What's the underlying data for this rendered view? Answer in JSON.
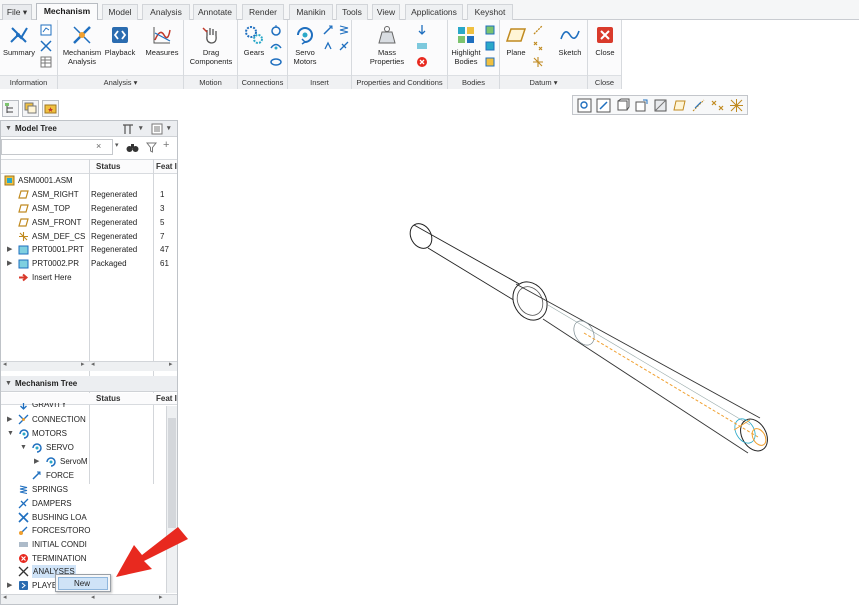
{
  "tabs": {
    "file": "File ▾",
    "mechanism": "Mechanism",
    "model": "Model",
    "analysis": "Analysis",
    "annotate": "Annotate",
    "render": "Render",
    "manikin": "Manikin",
    "tools": "Tools",
    "view": "View",
    "applications": "Applications",
    "keyshot": "Keyshot"
  },
  "ribbon": {
    "summary": "Summary",
    "mechanism_analysis_1": "Mechanism",
    "mechanism_analysis_2": "Analysis",
    "playback": "Playback",
    "measures": "Measures",
    "drag_1": "Drag",
    "drag_2": "Components",
    "gears": "Gears",
    "servo_1": "Servo",
    "servo_2": "Motors",
    "mass_1": "Mass",
    "mass_2": "Properties",
    "highlight_1": "Highlight",
    "highlight_2": "Bodies",
    "plane": "Plane",
    "sketch": "Sketch",
    "close": "Close",
    "groups": {
      "information": "Information",
      "analysis": "Analysis ▾",
      "motion": "Motion",
      "connections": "Connections",
      "insert": "Insert",
      "properties": "Properties and Conditions",
      "bodies": "Bodies",
      "datum": "Datum ▾",
      "close": "Close"
    }
  },
  "model_tree": {
    "title": "Model Tree",
    "col_status": "Status",
    "col_feat": "Feat I",
    "rows": [
      {
        "name": "ASM0001.ASM",
        "status": "",
        "feat": ""
      },
      {
        "name": "ASM_RIGHT",
        "status": "Regenerated",
        "feat": "1"
      },
      {
        "name": "ASM_TOP",
        "status": "Regenerated",
        "feat": "3"
      },
      {
        "name": "ASM_FRONT",
        "status": "Regenerated",
        "feat": "5"
      },
      {
        "name": "ASM_DEF_CS",
        "status": "Regenerated",
        "feat": "7"
      },
      {
        "name": "PRT0001.PRT",
        "status": "Regenerated",
        "feat": "47"
      },
      {
        "name": "PRT0002.PR",
        "status": "Packaged",
        "feat": "61"
      },
      {
        "name": "Insert Here",
        "status": "",
        "feat": ""
      }
    ]
  },
  "mechanism_tree": {
    "title": "Mechanism Tree",
    "col_status": "Status",
    "col_feat": "Feat I",
    "rows": [
      {
        "name": "GRAVITY"
      },
      {
        "name": "CONNECTION"
      },
      {
        "name": "MOTORS"
      },
      {
        "name": "SERVO"
      },
      {
        "name": "ServoM"
      },
      {
        "name": "FORCE"
      },
      {
        "name": "SPRINGS"
      },
      {
        "name": "DAMPERS"
      },
      {
        "name": "BUSHING LOA"
      },
      {
        "name": "FORCES/TORO"
      },
      {
        "name": "INITIAL CONDI"
      },
      {
        "name": "TERMINATION"
      },
      {
        "name": "ANALYSES"
      },
      {
        "name": "PLAYE"
      }
    ]
  },
  "context_menu": {
    "new": "New"
  },
  "colors": {
    "arrow": "#e8291f",
    "accent_blue": "#1f6fbf",
    "centerline": "#f0a030"
  }
}
